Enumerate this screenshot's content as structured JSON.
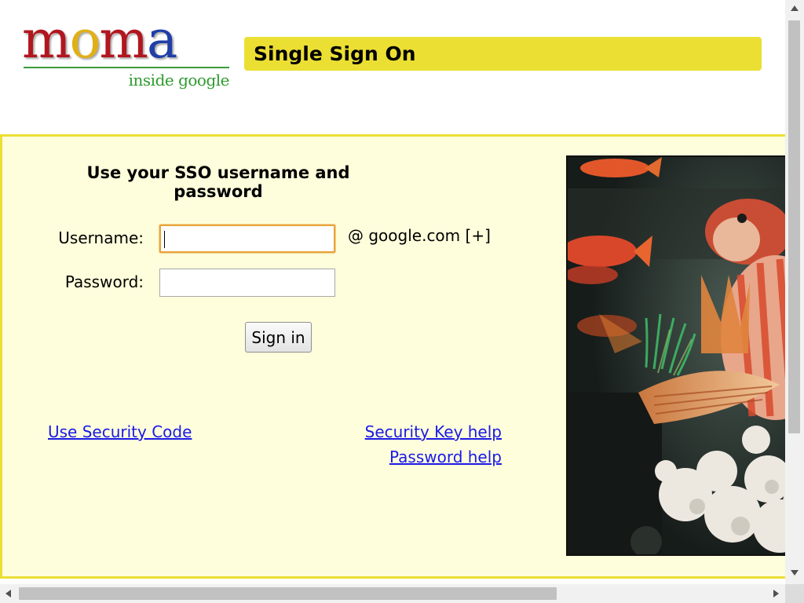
{
  "logo": {
    "letters": [
      "m",
      "o",
      "m",
      "a"
    ],
    "letter_colors": [
      "#b2161e",
      "#e0b015",
      "#b2161e",
      "#1f3ea8"
    ],
    "subtitle": "inside google"
  },
  "header": {
    "title": "Single Sign On"
  },
  "form": {
    "heading": "Use your SSO username and password",
    "username_label": "Username:",
    "username_value": "",
    "at_domain": "@  google.com [+]",
    "password_label": "Password:",
    "password_value": "",
    "signin_label": "Sign in"
  },
  "links": {
    "security_code": "Use Security Code",
    "security_key_help": "Security Key help",
    "password_help": "Password help"
  },
  "colors": {
    "accent_yellow": "#ebdf34",
    "panel_background": "#fefedc",
    "link_blue": "#1a1ae6",
    "focus_orange": "#e8a43b"
  },
  "image": {
    "subject": "aquarium-fish-photo"
  }
}
